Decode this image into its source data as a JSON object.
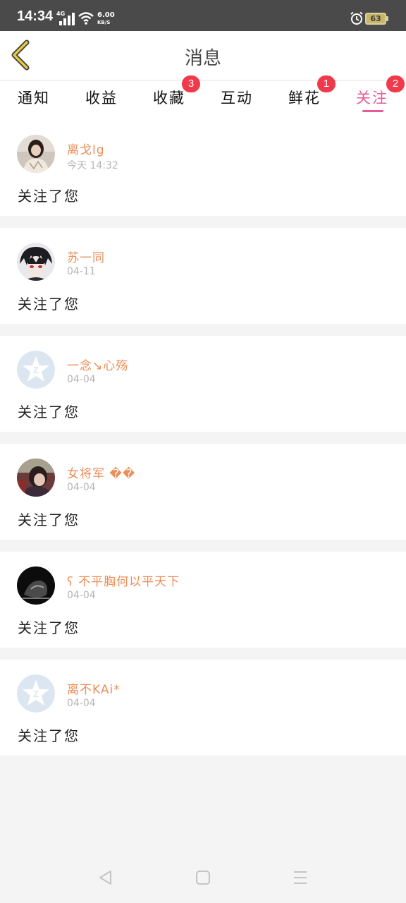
{
  "status_bar": {
    "time": "14:34",
    "network": "4G",
    "speed_value": "6.00",
    "speed_unit": "KB/S",
    "battery": "63"
  },
  "header": {
    "title": "消息",
    "back_icon": "chevron-left-icon",
    "accent": "#e8c743"
  },
  "tabs": [
    {
      "label": "通知",
      "badge": null,
      "active": false
    },
    {
      "label": "收益",
      "badge": null,
      "active": false
    },
    {
      "label": "收藏",
      "badge": "3",
      "active": false
    },
    {
      "label": "互动",
      "badge": null,
      "active": false
    },
    {
      "label": "鲜花",
      "badge": "1",
      "active": false
    },
    {
      "label": "关注",
      "badge": "2",
      "active": true
    }
  ],
  "colors": {
    "active_tab": "#ea5a9a",
    "badge": "#f0394a",
    "username": "#ec8e58",
    "timestamp": "#b5b5b5"
  },
  "notifications": [
    {
      "username": "离戈lg",
      "time": "今天 14:32",
      "action": "关注了您",
      "avatar": "photo-girl"
    },
    {
      "username": "苏一同",
      "time": "04-11",
      "action": "关注了您",
      "avatar": "photo-anime"
    },
    {
      "username": "一念↘心殇",
      "time": "04-04",
      "action": "关注了您",
      "avatar": "default"
    },
    {
      "username": "女将军 ��",
      "time": "04-04",
      "action": "关注了您",
      "avatar": "photo-woman"
    },
    {
      "username": "ʕ 不平胸何以平天下",
      "time": "04-04",
      "action": "关注了您",
      "avatar": "photo-dark"
    },
    {
      "username": "离不KAi*",
      "time": "04-04",
      "action": "关注了您",
      "avatar": "default"
    }
  ],
  "nav_bar": {
    "back": "triangle-back-icon",
    "home": "square-home-icon",
    "menu": "menu-lines-icon"
  }
}
